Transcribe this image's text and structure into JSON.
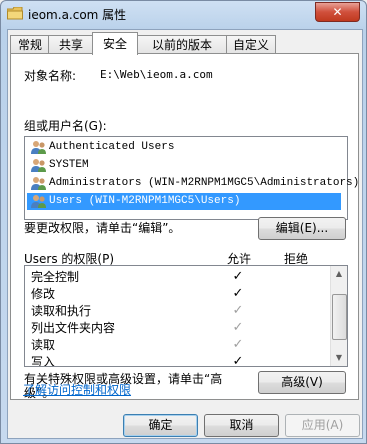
{
  "window": {
    "title": "ieom.a.com 属性",
    "close_label": "✕"
  },
  "tabs": [
    {
      "label": "常规"
    },
    {
      "label": "共享"
    },
    {
      "label": "安全"
    },
    {
      "label": "以前的版本"
    },
    {
      "label": "自定义"
    }
  ],
  "security": {
    "object_name_label": "对象名称:",
    "object_name_value": "E:\\Web\\ieom.a.com",
    "groups_label": "组或用户名(G):",
    "groups": [
      {
        "name": "Authenticated Users"
      },
      {
        "name": "SYSTEM"
      },
      {
        "name": "Administrators (WIN-M2RNPM1MGC5\\Administrators)"
      },
      {
        "name": "Users (WIN-M2RNPM1MGC5\\Users)",
        "selected": true
      }
    ],
    "change_perm_text": "要更改权限，请单击“编辑”。",
    "edit_button": "编辑(E)...",
    "perm_header": "Users 的权限(P)",
    "allow_header": "允许",
    "deny_header": "拒绝",
    "permissions": [
      {
        "name": "完全控制",
        "allow": "✓",
        "allow_gray": false
      },
      {
        "name": "修改",
        "allow": "✓",
        "allow_gray": false
      },
      {
        "name": "读取和执行",
        "allow": "✓",
        "allow_gray": true
      },
      {
        "name": "列出文件夹内容",
        "allow": "✓",
        "allow_gray": true
      },
      {
        "name": "读取",
        "allow": "✓",
        "allow_gray": true
      },
      {
        "name": "写入",
        "allow": "✓",
        "allow_gray": false
      }
    ],
    "special_text_1": "有关特殊权限或高级设置，请单击“高",
    "special_text_2": "级”。",
    "advanced_button": "高级(V)",
    "learn_link": "了解访问控制和权限"
  },
  "footer": {
    "ok": "确定",
    "cancel": "取消",
    "apply": "应用(A)"
  }
}
